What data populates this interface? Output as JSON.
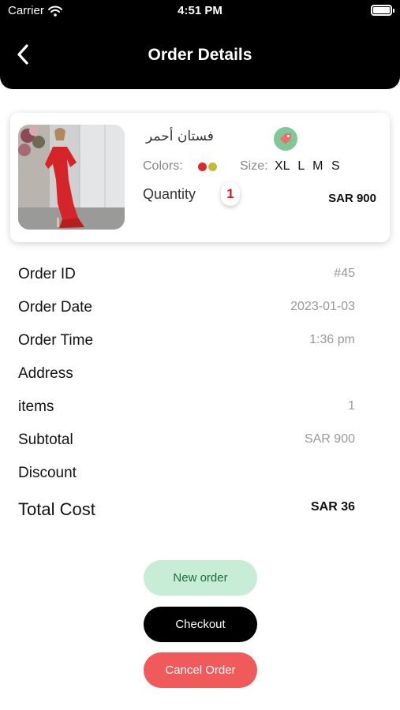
{
  "status_bar": {
    "carrier": "Carrier",
    "time": "4:51 PM"
  },
  "header": {
    "title": "Order Details"
  },
  "product": {
    "name": "فستان أحمر",
    "colors_label": "Colors:",
    "colors": [
      "#e3262c",
      "#c2bb35"
    ],
    "size_label": "Size:",
    "sizes": "XL L M S",
    "quantity_label": "Quantity",
    "quantity": "1",
    "price": "SAR 900"
  },
  "details": [
    {
      "label": "Order ID",
      "value": "#45"
    },
    {
      "label": "Order Date",
      "value": "2023-01-03"
    },
    {
      "label": "Order Time",
      "value": "1:36 pm"
    },
    {
      "label": "Address",
      "value": ""
    },
    {
      "label": "items",
      "value": "1"
    },
    {
      "label": "Subtotal",
      "value": "SAR 900"
    },
    {
      "label": "Discount",
      "value": ""
    }
  ],
  "total": {
    "label": "Total Cost",
    "value": "SAR 36"
  },
  "buttons": {
    "new_order": "New order",
    "checkout": "Checkout",
    "cancel": "Cancel Order"
  },
  "icons": {
    "back": "chevron-left-icon",
    "tag": "price-tag-icon",
    "wifi": "wifi-icon",
    "battery": "battery-icon"
  }
}
